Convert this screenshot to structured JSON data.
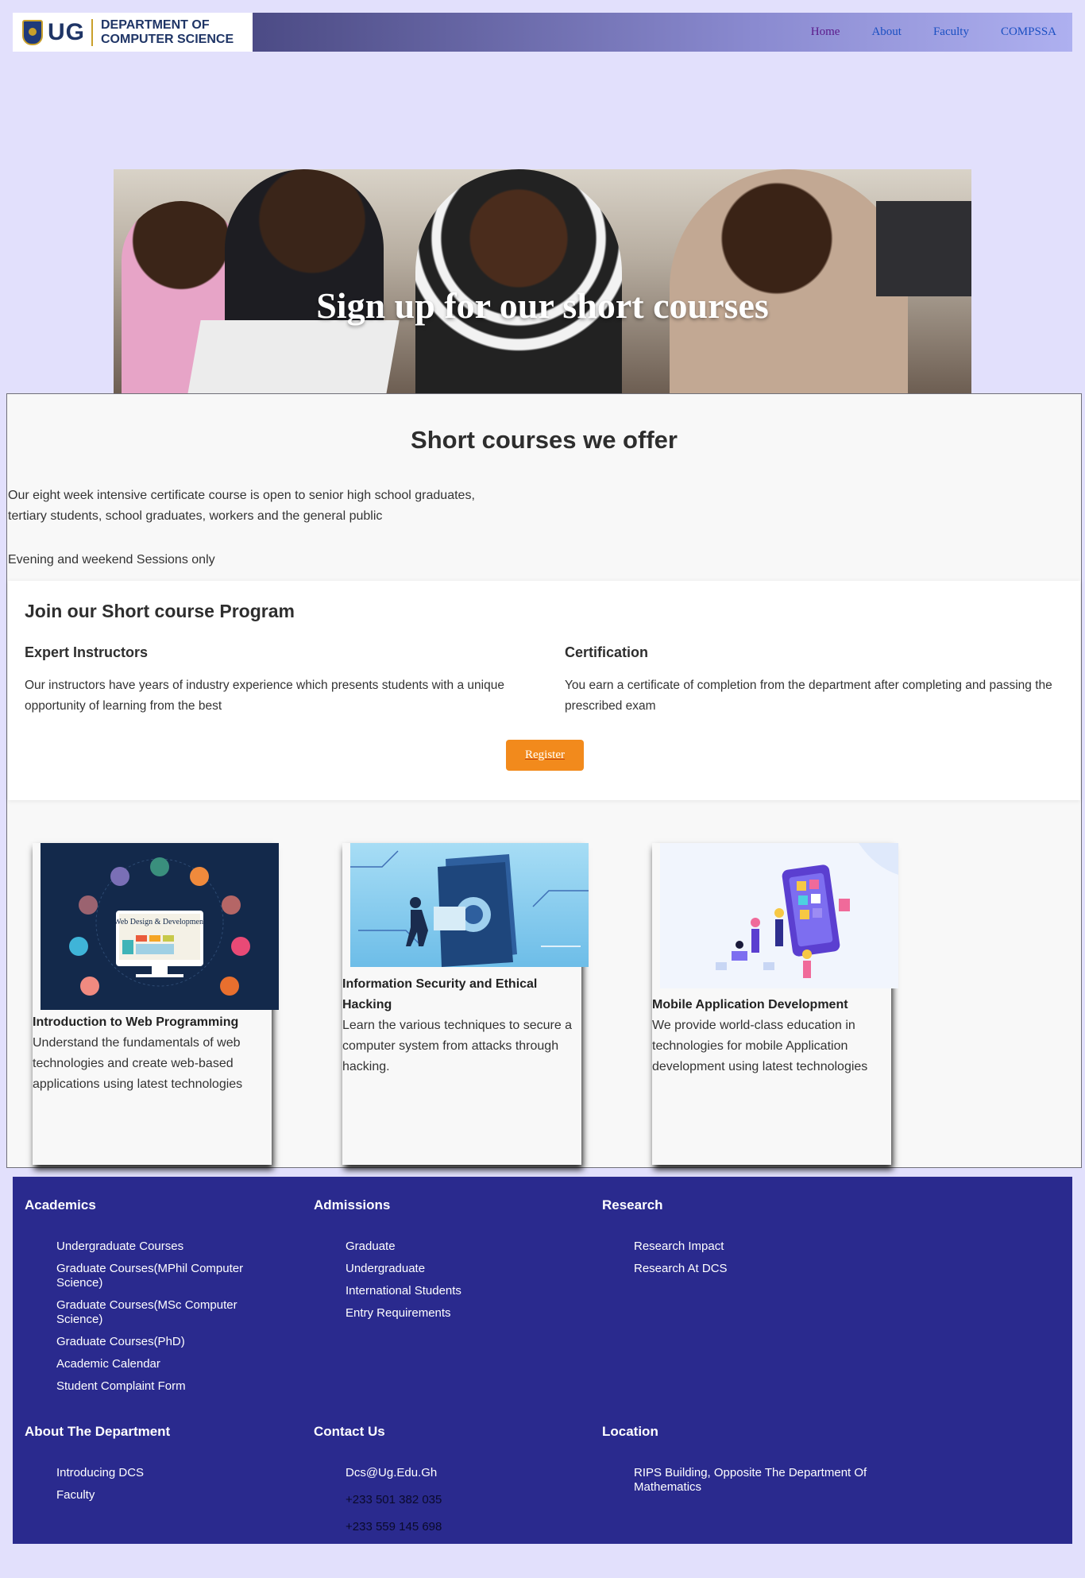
{
  "header": {
    "logo_mark": "UG",
    "logo_line1": "DEPARTMENT OF",
    "logo_line2": "COMPUTER SCIENCE",
    "nav": [
      "Home",
      "About",
      "Faculty",
      "COMPSSA"
    ]
  },
  "hero": {
    "title": "Sign up for our short courses"
  },
  "main": {
    "heading": "Short courses we offer",
    "intro_line1": "Our eight week intensive certificate course is open to senior high school graduates,",
    "intro_line2": "tertiary students, school graduates, workers and the general public",
    "sessions": "Evening and weekend Sessions only"
  },
  "join": {
    "heading": "Join our Short course Program",
    "instructors_title": "Expert Instructors",
    "instructors_text": "Our instructors have years of industry experience which presents students with a unique opportunity of learning from the best",
    "cert_title": "Certification",
    "cert_text": "You earn a certificate of completion from the department after completing and passing the prescribed exam",
    "register": "Register"
  },
  "courses": [
    {
      "title": "Introduction to Web Programming",
      "description": "Understand the fundamentals of web technologies and create web-based applications using latest technologies",
      "image_text": "Web Design & Development"
    },
    {
      "title": "Information Security and Ethical Hacking",
      "description": "Learn the various techniques to secure a computer system from attacks through hacking."
    },
    {
      "title": "Mobile Application Development",
      "description": "We provide world-class education in technologies for mobile Application development using latest technologies"
    }
  ],
  "footer": {
    "academics": {
      "title": "Academics",
      "items": [
        "Undergraduate Courses",
        "Graduate Courses(MPhil Computer Science)",
        "Graduate Courses(MSc Computer Science)",
        "Graduate Courses(PhD)",
        "Academic Calendar",
        "Student Complaint Form"
      ]
    },
    "admissions": {
      "title": "Admissions",
      "items": [
        "Graduate",
        "Undergraduate",
        "International Students",
        "Entry Requirements"
      ]
    },
    "research": {
      "title": "Research",
      "items": [
        "Research Impact",
        "Research At DCS"
      ]
    },
    "about": {
      "title": "About The Department",
      "items": [
        "Introducing DCS",
        "Faculty"
      ]
    },
    "contact": {
      "title": "Contact Us",
      "email": "Dcs@Ug.Edu.Gh",
      "phone1": "+233 501 382 035",
      "phone2": "+233 559 145 698"
    },
    "location": {
      "title": "Location",
      "address": "RIPS Building, Opposite The Department Of Mathematics"
    }
  },
  "colors": {
    "page_bg": "#e2e0fc",
    "footer_bg": "#2a2a8e",
    "button": "#f28a1c",
    "nav_link": "#1a4fc2"
  }
}
